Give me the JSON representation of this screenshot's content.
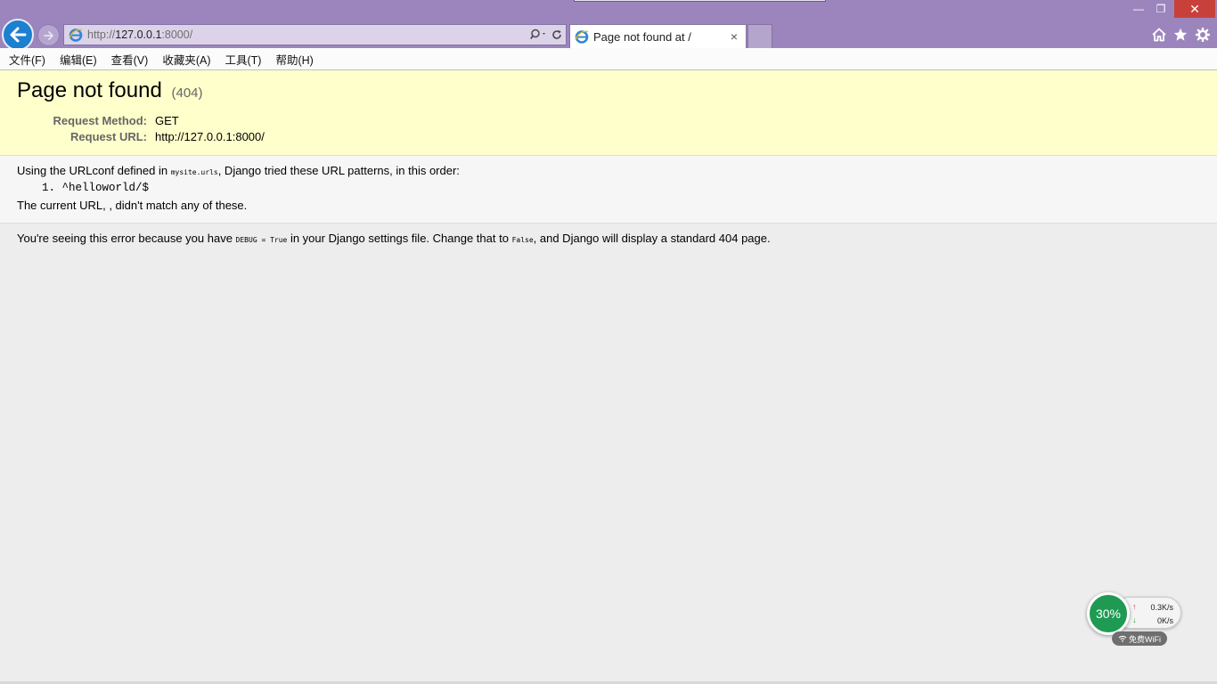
{
  "browser": {
    "address": {
      "scheme": "http://",
      "host": "127.0.0.1",
      "port_path": ":8000/"
    },
    "tab": {
      "title": "Page not found at /",
      "close": "×"
    },
    "window_controls": {
      "minimize": "—",
      "maximize": "❐",
      "close": "✕"
    },
    "menu": [
      {
        "label": "文件(F)"
      },
      {
        "label": "编辑(E)"
      },
      {
        "label": "查看(V)"
      },
      {
        "label": "收藏夹(A)"
      },
      {
        "label": "工具(T)"
      },
      {
        "label": "帮助(H)"
      }
    ],
    "icons": {
      "back": "arrow-left-icon",
      "forward": "arrow-right-icon",
      "search": "search-icon",
      "refresh": "refresh-icon",
      "home": "home-icon",
      "favorites": "star-icon",
      "settings": "gear-icon"
    },
    "colors": {
      "chrome": "#9c85bd",
      "back_button": "#1d7fd0",
      "close_button": "#c7413a"
    }
  },
  "page": {
    "summary": {
      "title": "Page not found",
      "code": "(404)",
      "request_method_label": "Request Method:",
      "request_method": "GET",
      "request_url_label": "Request URL:",
      "request_url": "http://127.0.0.1:8000/"
    },
    "info": {
      "line1_prefix": "Using the URLconf defined in ",
      "urlconf": "mysite.urls",
      "line1_suffix": ", Django tried these URL patterns, in this order:",
      "patterns": [
        {
          "number": "1.",
          "pattern": "^helloworld/$"
        }
      ],
      "line2": "The current URL, , didn't match any of these."
    },
    "explanation": {
      "prefix": "You're seeing this error because you have ",
      "debug_code": "DEBUG = True",
      "middle": " in your Django settings file. Change that to ",
      "false_code": "False",
      "suffix": ", and Django will display a standard 404 page."
    },
    "colors": {
      "summary_bg": "#ffffcc",
      "info_bg": "#f6f6f6",
      "page_bg": "#ededed"
    }
  },
  "net_widget": {
    "percent": "30%",
    "upload": "0.3K/s",
    "download": "0K/s",
    "up_arrow": "↑",
    "down_arrow": "↓",
    "wifi_label": "免费WiFi",
    "color": "#1f9a52"
  }
}
